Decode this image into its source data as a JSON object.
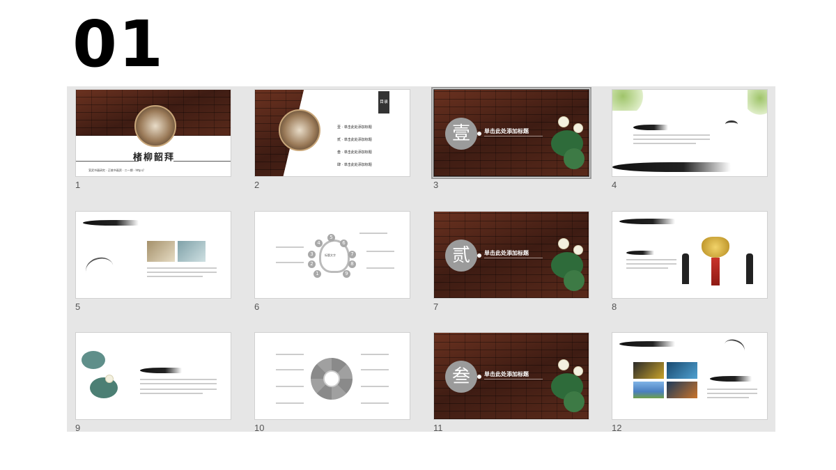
{
  "page": {
    "title": "01"
  },
  "slides": [
    {
      "number": "1",
      "title": "楮柳韶拜",
      "footer": "宣武书画研究 · 正统书画资 · 二一期 · http://"
    },
    {
      "number": "2",
      "tag": "目录",
      "items": [
        "壹 · 单击此处添加标题",
        "贰 · 单击此处添加标题",
        "叁 · 单击此处添加标题",
        "肆 · 单击此处添加标题"
      ]
    },
    {
      "number": "3",
      "seal": "壹",
      "title": "单击此处添加标题"
    },
    {
      "number": "4"
    },
    {
      "number": "5"
    },
    {
      "number": "6",
      "center": "标题文字"
    },
    {
      "number": "7",
      "seal": "贰",
      "title": "单击此处添加标题"
    },
    {
      "number": "8"
    },
    {
      "number": "9"
    },
    {
      "number": "10"
    },
    {
      "number": "11",
      "seal": "叁",
      "title": "单击此处添加标题"
    },
    {
      "number": "12"
    }
  ],
  "colors": {
    "brick": "#4a2318",
    "seal": "#9b9b9b",
    "sorter_bg": "#e6e6e6"
  }
}
